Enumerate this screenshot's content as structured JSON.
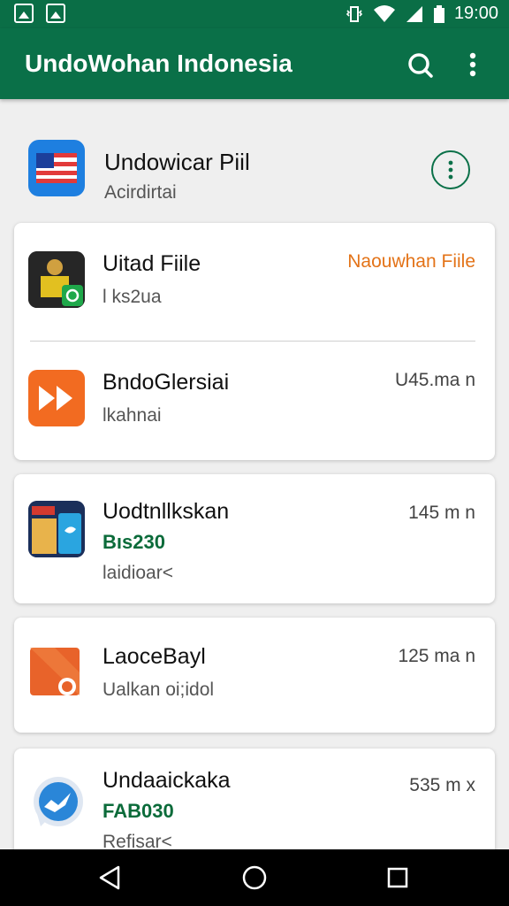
{
  "status_bar": {
    "time": "19:00",
    "icons": [
      "gallery-icon",
      "image-icon",
      "vibrate-icon",
      "wifi-icon",
      "signal-icon",
      "battery-icon"
    ]
  },
  "app_bar": {
    "title": "UndoWohan Indonesia",
    "icons": [
      "search-icon",
      "more-vert-icon"
    ],
    "color": "#0a7048"
  },
  "header": {
    "title": "Undowicar Piil",
    "subtitle": "Acirdirtai",
    "icon": "flag-icon"
  },
  "cards": [
    {
      "items": [
        {
          "title": "Uitad Fiile",
          "subtitle": "l ks2ua",
          "meta": "Naouwhan Fiile",
          "meta_color": "#e37318",
          "icon": "photo-app-icon"
        },
        {
          "title": "BndoGlersiai",
          "subtitle": "lkahnai",
          "meta": "U45.ma n",
          "icon": "fast-forward-icon"
        }
      ]
    },
    {
      "items": [
        {
          "title": "Uodtnllkskan",
          "accent": "Bıs230",
          "subtitle": "laidioar<",
          "meta": "145 m n",
          "icon": "collage-app-icon"
        }
      ]
    },
    {
      "items": [
        {
          "title": "LaoceBayl",
          "subtitle": "Ualkan oi;idol",
          "meta": "125 ma n",
          "icon": "folder-app-icon"
        }
      ]
    },
    {
      "items": [
        {
          "title": "Undaaickaka",
          "accent": "FAB030",
          "subtitle": "Refisar<",
          "meta": "535 m x",
          "icon": "chat-bubble-icon"
        }
      ]
    }
  ],
  "nav_bar": {
    "icons": [
      "back-icon",
      "home-icon",
      "recents-icon"
    ]
  }
}
